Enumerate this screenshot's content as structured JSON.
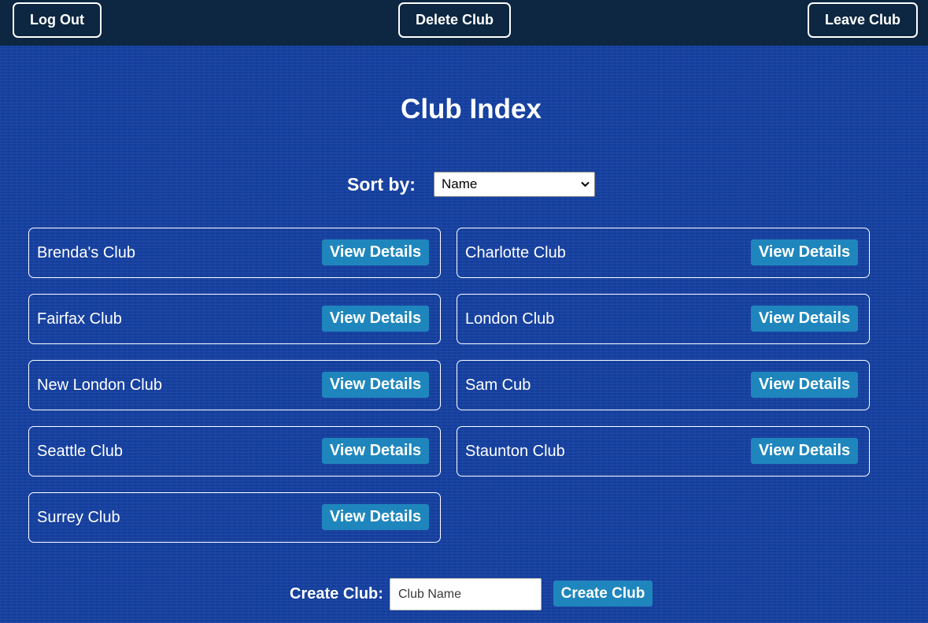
{
  "header": {
    "logout_label": "Log Out",
    "delete_label": "Delete Club",
    "leave_label": "Leave Club"
  },
  "page": {
    "title": "Club Index"
  },
  "sort": {
    "label": "Sort by:",
    "selected": "Name"
  },
  "clubs": [
    {
      "name": "Brenda's Club",
      "button": "View Details"
    },
    {
      "name": "Charlotte Club",
      "button": "View Details"
    },
    {
      "name": "Fairfax Club",
      "button": "View Details"
    },
    {
      "name": "London Club",
      "button": "View Details"
    },
    {
      "name": "New London Club",
      "button": "View Details"
    },
    {
      "name": "Sam Cub",
      "button": "View Details"
    },
    {
      "name": "Seattle Club",
      "button": "View Details"
    },
    {
      "name": "Staunton Club",
      "button": "View Details"
    },
    {
      "name": "Surrey Club",
      "button": "View Details"
    }
  ],
  "create": {
    "label": "Create Club:",
    "placeholder": "Club Name",
    "button": "Create Club"
  },
  "colors": {
    "page_background": "#1541a3",
    "header_background": "#0d2641",
    "button_accent": "#1f86bd"
  }
}
